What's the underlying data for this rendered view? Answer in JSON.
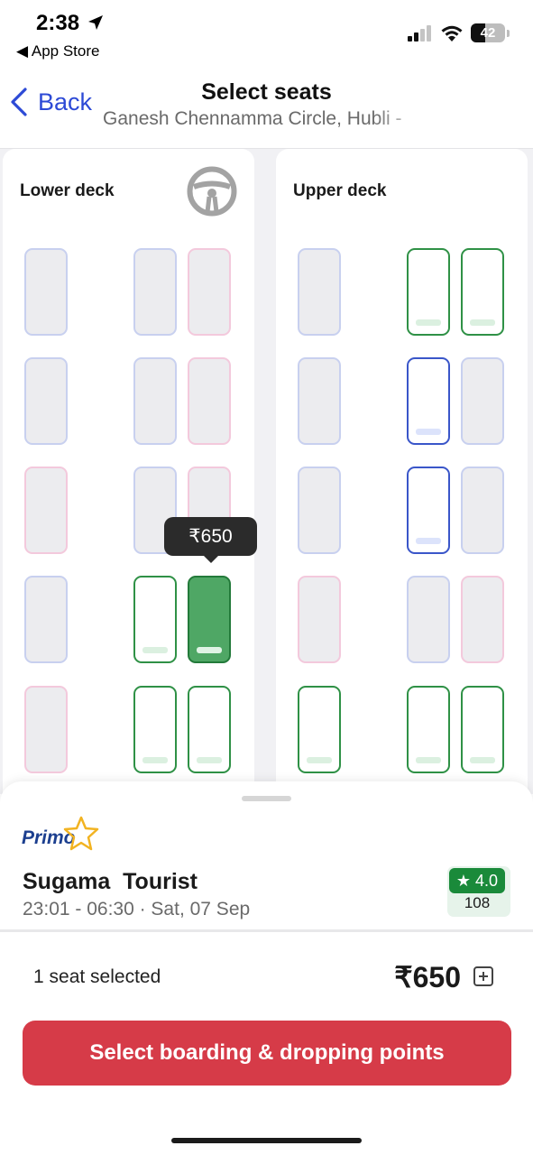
{
  "status_bar": {
    "time": "2:38",
    "back_app": "◀ App Store",
    "battery": "42",
    "battery_level": 0.42
  },
  "nav": {
    "back_label": "Back",
    "title": "Select seats",
    "subtitle": "Ganesh Chennamma Circle, Hubli -"
  },
  "decks": {
    "lower_label": "Lower deck",
    "upper_label": "Upper deck"
  },
  "seat_status_legend": [
    "male-booked",
    "female-booked",
    "available",
    "male-only-available",
    "selected"
  ],
  "lower_deck_rows": [
    [
      "male-booked",
      "male-booked",
      "female-booked"
    ],
    [
      "male-booked",
      "male-booked",
      "female-booked"
    ],
    [
      "female-booked",
      "male-booked",
      "female-booked"
    ],
    [
      "male-booked",
      "available",
      "selected"
    ],
    [
      "female-booked",
      "available",
      "available"
    ]
  ],
  "upper_deck_rows": [
    [
      "male-booked",
      "available",
      "available"
    ],
    [
      "male-booked",
      "male-only-available",
      "male-booked"
    ],
    [
      "male-booked",
      "male-only-available",
      "male-booked"
    ],
    [
      "female-booked",
      "male-booked",
      "female-booked"
    ],
    [
      "available",
      "available",
      "available"
    ]
  ],
  "tooltip": {
    "price": "₹650"
  },
  "operator": {
    "badge": "Primo",
    "name": "Sugama  Tourist",
    "times": "23:01 - 06:30 · Sat, 07 Sep",
    "rating": "★ 4.0",
    "rating_count": "108"
  },
  "summary": {
    "seats_selected": "1 seat selected",
    "total": "₹650"
  },
  "cta": {
    "label": "Select boarding & dropping points"
  },
  "colors": {
    "accent_blue": "#2d4ad6",
    "available_green": "#2f9146",
    "selected_green": "#4fa765",
    "cta_red": "#d63b48",
    "rating_green": "#1a8a3a"
  }
}
